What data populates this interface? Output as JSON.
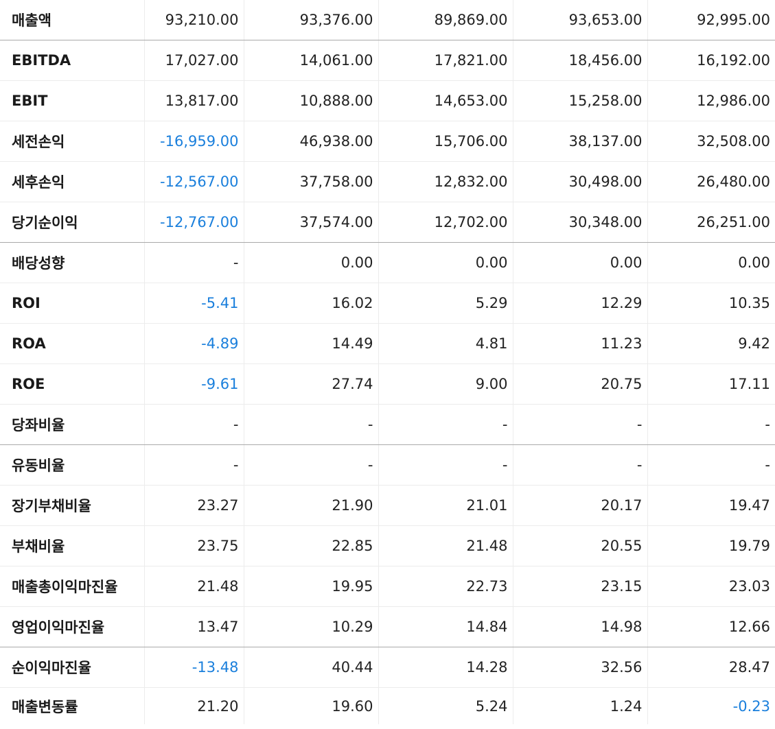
{
  "colors": {
    "negative": "#1a7fdc",
    "text": "#222222",
    "divider_strong": "#a9a9a9",
    "divider_light": "#ececec"
  },
  "rows": [
    {
      "label": "매출액",
      "values": [
        "93,210.00",
        "93,376.00",
        "89,869.00",
        "93,653.00",
        "92,995.00"
      ],
      "group_end": true
    },
    {
      "label": "EBITDA",
      "values": [
        "17,027.00",
        "14,061.00",
        "17,821.00",
        "18,456.00",
        "16,192.00"
      ],
      "group_end": false
    },
    {
      "label": "EBIT",
      "values": [
        "13,817.00",
        "10,888.00",
        "14,653.00",
        "15,258.00",
        "12,986.00"
      ],
      "group_end": false
    },
    {
      "label": "세전손익",
      "values": [
        "-16,959.00",
        "46,938.00",
        "15,706.00",
        "38,137.00",
        "32,508.00"
      ],
      "group_end": false
    },
    {
      "label": "세후손익",
      "values": [
        "-12,567.00",
        "37,758.00",
        "12,832.00",
        "30,498.00",
        "26,480.00"
      ],
      "group_end": false
    },
    {
      "label": "당기순이익",
      "values": [
        "-12,767.00",
        "37,574.00",
        "12,702.00",
        "30,348.00",
        "26,251.00"
      ],
      "group_end": true
    },
    {
      "label": "배당성향",
      "values": [
        "-",
        "0.00",
        "0.00",
        "0.00",
        "0.00"
      ],
      "group_end": false
    },
    {
      "label": "ROI",
      "values": [
        "-5.41",
        "16.02",
        "5.29",
        "12.29",
        "10.35"
      ],
      "group_end": false
    },
    {
      "label": "ROA",
      "values": [
        "-4.89",
        "14.49",
        "4.81",
        "11.23",
        "9.42"
      ],
      "group_end": false
    },
    {
      "label": "ROE",
      "values": [
        "-9.61",
        "27.74",
        "9.00",
        "20.75",
        "17.11"
      ],
      "group_end": false
    },
    {
      "label": "당좌비율",
      "values": [
        "-",
        "-",
        "-",
        "-",
        "-"
      ],
      "group_end": true
    },
    {
      "label": "유동비율",
      "values": [
        "-",
        "-",
        "-",
        "-",
        "-"
      ],
      "group_end": false
    },
    {
      "label": "장기부채비율",
      "values": [
        "23.27",
        "21.90",
        "21.01",
        "20.17",
        "19.47"
      ],
      "group_end": false
    },
    {
      "label": "부채비율",
      "values": [
        "23.75",
        "22.85",
        "21.48",
        "20.55",
        "19.79"
      ],
      "group_end": false
    },
    {
      "label": "매출총이익마진율",
      "values": [
        "21.48",
        "19.95",
        "22.73",
        "23.15",
        "23.03"
      ],
      "group_end": false
    },
    {
      "label": "영업이익마진율",
      "values": [
        "13.47",
        "10.29",
        "14.84",
        "14.98",
        "12.66"
      ],
      "group_end": true
    },
    {
      "label": "순이익마진율",
      "values": [
        "-13.48",
        "40.44",
        "14.28",
        "32.56",
        "28.47"
      ],
      "group_end": false
    },
    {
      "label": "매출변동률",
      "values": [
        "21.20",
        "19.60",
        "5.24",
        "1.24",
        "-0.23"
      ],
      "group_end": false
    }
  ]
}
